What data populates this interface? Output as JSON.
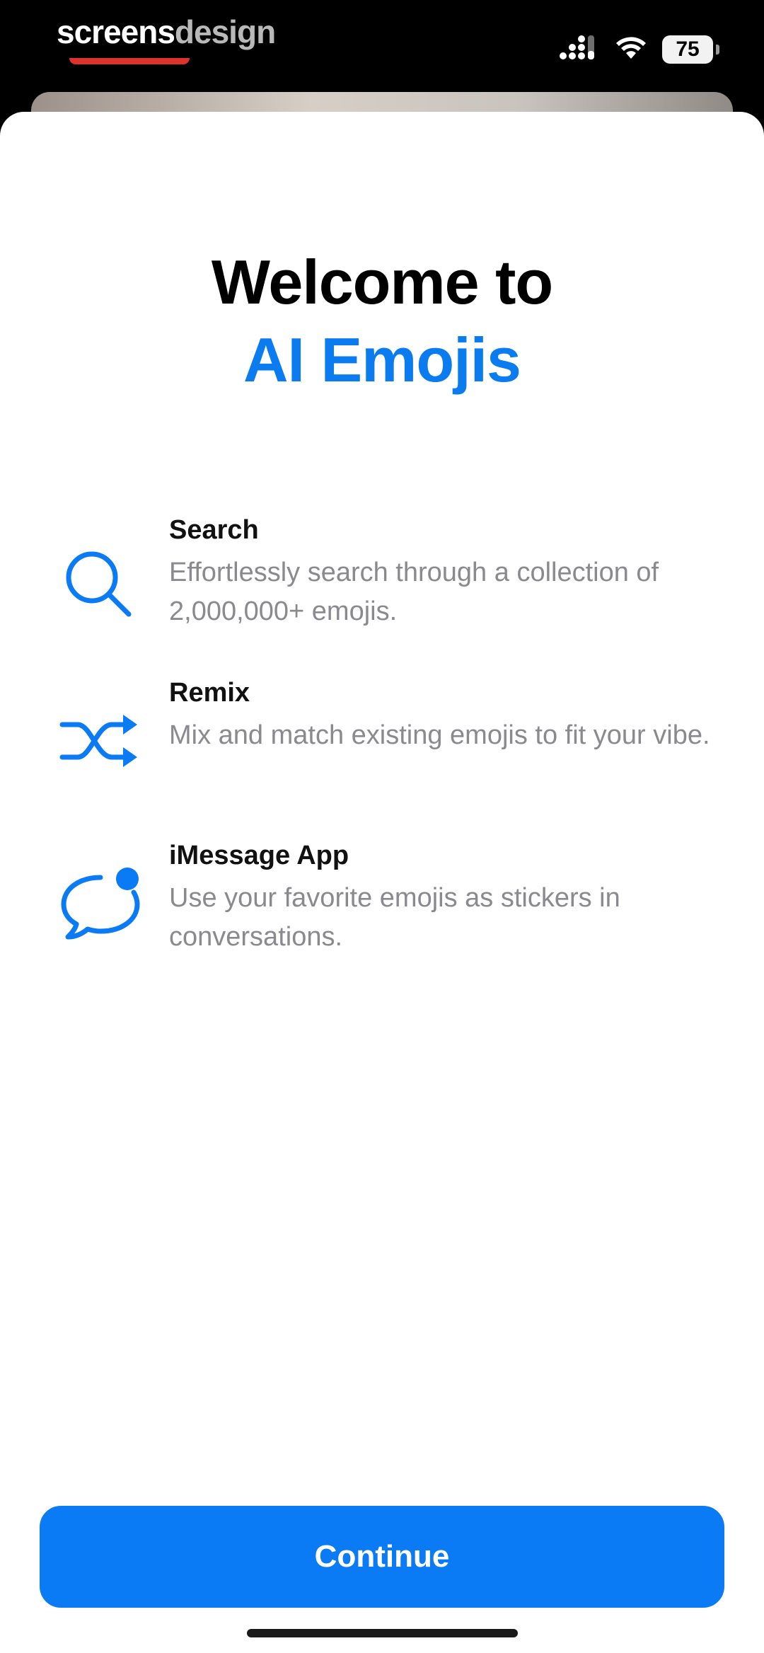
{
  "status_bar": {
    "watermark_part1": "screens",
    "watermark_part2": "design",
    "battery": "75"
  },
  "header": {
    "title_line1": "Welcome to",
    "title_line2": "AI Emojis"
  },
  "features": [
    {
      "title": "Search",
      "description": "Effortlessly search through a collection of 2,000,000+ emojis.",
      "icon": "search-icon"
    },
    {
      "title": "Remix",
      "description": "Mix and match existing emojis to fit your vibe.",
      "icon": "shuffle-icon"
    },
    {
      "title": "iMessage App",
      "description": "Use your favorite emojis as stickers in conversations.",
      "icon": "message-bubble-icon"
    }
  ],
  "footer": {
    "continue_label": "Continue"
  },
  "colors": {
    "accent": "#0A7BF5",
    "title": "#000000",
    "secondary_text": "#8A8A8E"
  }
}
